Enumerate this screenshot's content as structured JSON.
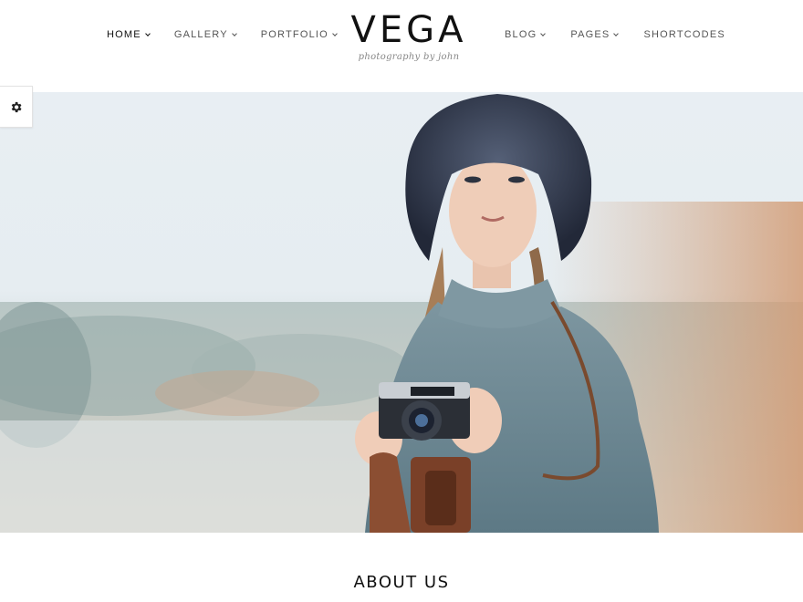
{
  "nav_left": [
    {
      "label": "HOME",
      "active": true
    },
    {
      "label": "GALLERY"
    },
    {
      "label": "PORTFOLIO"
    }
  ],
  "nav_right": [
    {
      "label": "BLOG"
    },
    {
      "label": "PAGES"
    },
    {
      "label": "SHORTCODES"
    }
  ],
  "logo": {
    "title": "VEGA",
    "tagline": "photography by john"
  },
  "settings": {
    "icon": "gear-icon"
  },
  "hero": {
    "image": "woman-with-camera-photo"
  },
  "about": {
    "title": "ABOUT US"
  }
}
